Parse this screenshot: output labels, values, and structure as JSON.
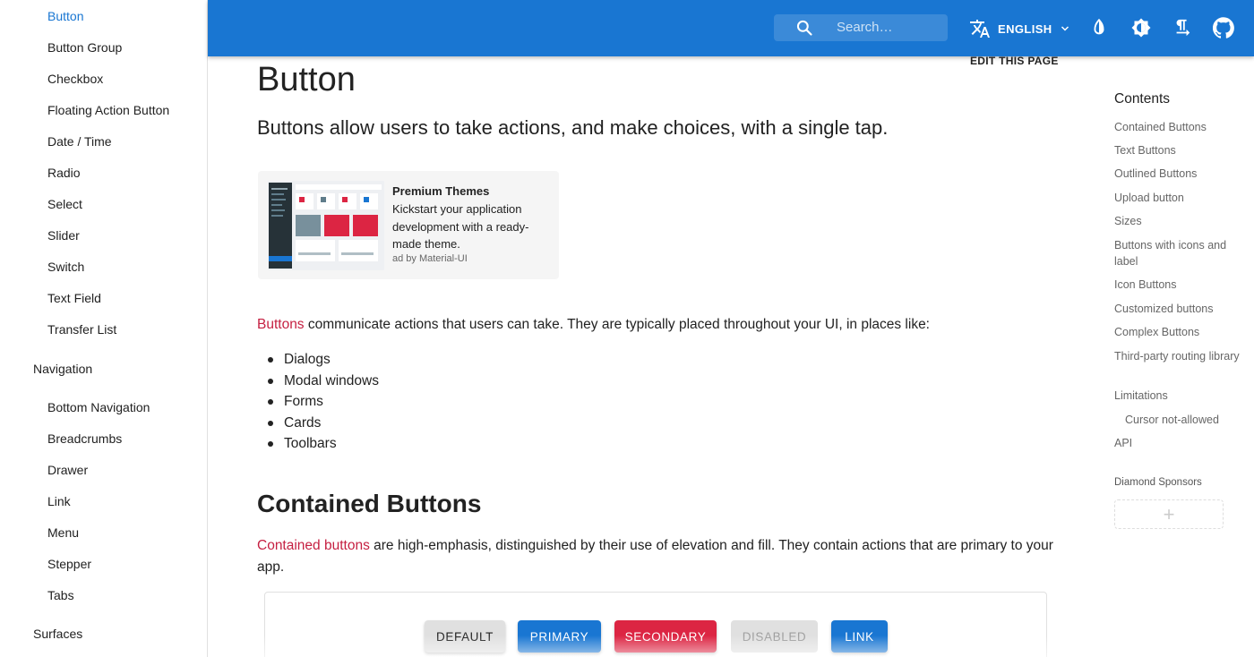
{
  "sidebar": {
    "items": [
      {
        "label": "Button",
        "active": true
      },
      {
        "label": "Button Group"
      },
      {
        "label": "Checkbox"
      },
      {
        "label": "Floating Action Button"
      },
      {
        "label": "Date / Time"
      },
      {
        "label": "Radio"
      },
      {
        "label": "Select"
      },
      {
        "label": "Slider"
      },
      {
        "label": "Switch"
      },
      {
        "label": "Text Field"
      },
      {
        "label": "Transfer List"
      }
    ],
    "navigation_heading": "Navigation",
    "navigation_items": [
      {
        "label": "Bottom Navigation"
      },
      {
        "label": "Breadcrumbs"
      },
      {
        "label": "Drawer"
      },
      {
        "label": "Link"
      },
      {
        "label": "Menu"
      },
      {
        "label": "Stepper"
      },
      {
        "label": "Tabs"
      }
    ],
    "surfaces_heading": "Surfaces"
  },
  "appbar": {
    "search_placeholder": "Search…",
    "language_label": "ENGLISH",
    "icons": [
      "search-icon",
      "translate-icon",
      "chevron-down-icon",
      "theme-toggle-icon",
      "brightness-icon",
      "text-direction-icon",
      "github-icon"
    ],
    "color": "#1976d2"
  },
  "main": {
    "edit_page": "EDIT THIS PAGE",
    "title": "Button",
    "subtitle": "Buttons allow users to take actions, and make choices, with a single tap.",
    "ad": {
      "title": "Premium Themes",
      "text": "Kickstart your application development with a ready-made theme.",
      "by": "ad by Material-UI"
    },
    "intro_link": "Buttons",
    "intro_text": " communicate actions that users can take. They are typically placed throughout your UI, in places like:",
    "bullets": [
      "Dialogs",
      "Modal windows",
      "Forms",
      "Cards",
      "Toolbars"
    ],
    "section_title": "Contained Buttons",
    "section_link": "Contained buttons",
    "section_text": " are high-emphasis, distinguished by their use of elevation and fill. They contain actions that are primary to your app.",
    "demo_buttons": {
      "default": "DEFAULT",
      "primary": "PRIMARY",
      "secondary": "SECONDARY",
      "disabled": "DISABLED",
      "link": "LINK"
    }
  },
  "toc": {
    "title": "Contents",
    "items": [
      {
        "label": "Contained Buttons"
      },
      {
        "label": "Text Buttons"
      },
      {
        "label": "Outlined Buttons"
      },
      {
        "label": "Upload button"
      },
      {
        "label": "Sizes"
      },
      {
        "label": "Buttons with icons and label"
      },
      {
        "label": "Icon Buttons"
      },
      {
        "label": "Customized buttons"
      },
      {
        "label": "Complex Buttons"
      },
      {
        "label": "Third-party routing library"
      },
      {
        "label": "Limitations"
      },
      {
        "label": "Cursor not-allowed"
      },
      {
        "label": "API"
      }
    ],
    "sponsors_label": "Diamond Sponsors",
    "sponsor_placeholder": "+"
  },
  "colors": {
    "primary": "#1976d2",
    "secondary": "#dc2543",
    "link": "#c51f41"
  }
}
